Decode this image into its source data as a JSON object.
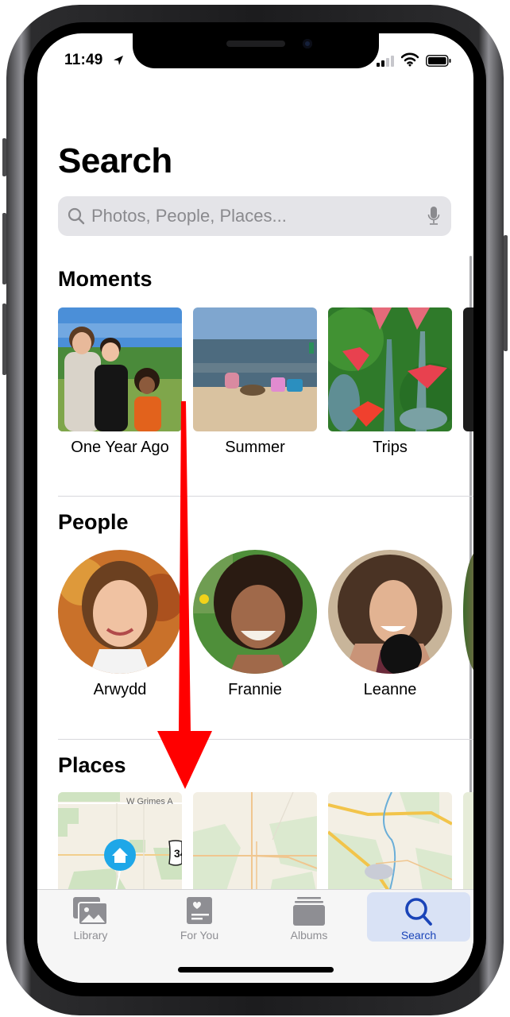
{
  "status_bar": {
    "time": "11:49",
    "location_icon": "location-arrow-icon",
    "signal_icon": "cellular-signal-icon",
    "wifi_icon": "wifi-icon",
    "battery_icon": "battery-icon"
  },
  "header": {
    "title": "Search"
  },
  "search": {
    "placeholder": "Photos, People, Places...",
    "value": "",
    "search_icon": "magnifier-icon",
    "mic_icon": "microphone-icon"
  },
  "sections": {
    "moments": {
      "title": "Moments",
      "items": [
        {
          "label": "One Year Ago",
          "thumbnail": "photo of three kids in front of trees"
        },
        {
          "label": "Summer",
          "thumbnail": "photo of children playing on a beach"
        },
        {
          "label": "Trips",
          "thumbnail": "photo of pink succulent flowers"
        }
      ]
    },
    "people": {
      "title": "People",
      "items": [
        {
          "name": "Arwydd"
        },
        {
          "name": "Frannie"
        },
        {
          "name": "Leanne"
        }
      ]
    },
    "places": {
      "title": "Places",
      "items": [
        {
          "map_label": "W Grimes A",
          "route_shield": "34",
          "pin_icon": "home-icon"
        },
        {
          "map_label": ""
        },
        {
          "map_label": ""
        }
      ]
    }
  },
  "tab_bar": {
    "tabs": [
      {
        "label": "Library",
        "icon": "photo-library-icon",
        "active": false
      },
      {
        "label": "For You",
        "icon": "for-you-icon",
        "active": false
      },
      {
        "label": "Albums",
        "icon": "albums-icon",
        "active": false
      },
      {
        "label": "Search",
        "icon": "search-icon",
        "active": true
      }
    ]
  },
  "annotation": {
    "arrow": "red-down-arrow",
    "color": "#ff0000"
  },
  "colors": {
    "accent": "#1a44b8",
    "tab_active_bg": "#d9e2f5",
    "search_bg": "#e4e4e8",
    "map_pin": "#1ea7e8"
  }
}
